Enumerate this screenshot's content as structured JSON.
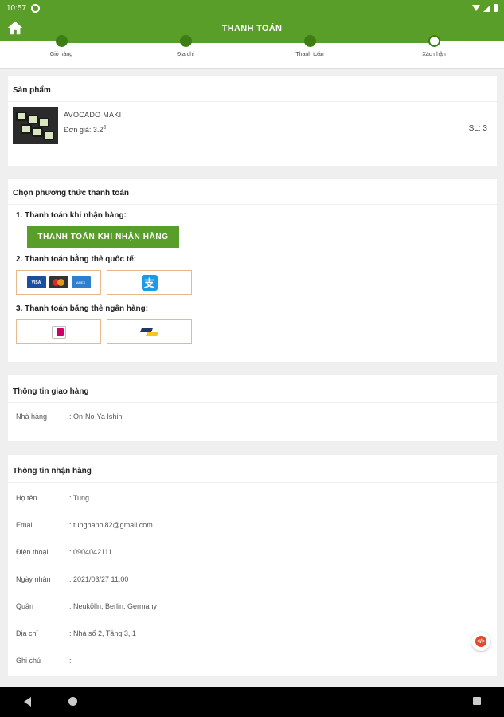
{
  "status_bar": {
    "time": "10:57"
  },
  "app_bar": {
    "title": "THANH TOÁN"
  },
  "steps": [
    {
      "label": "Giỏ hàng",
      "done": true
    },
    {
      "label": "Địa chỉ",
      "done": true
    },
    {
      "label": "Thanh toán",
      "done": true
    },
    {
      "label": "Xác nhận",
      "done": false
    }
  ],
  "product_section": {
    "title": "Sản phẩm",
    "item": {
      "name": "AVOCADO MAKI",
      "price_label": "Đơn giá: 3.2",
      "currency_sup": "đ",
      "qty": "SL: 3"
    }
  },
  "payment_section": {
    "title": "Chọn phương thức thanh toán",
    "option1_label": "1. Thanh toán khi nhận hàng:",
    "cod_button": "THANH TOÁN KHI NHẬN HÀNG",
    "option2_label": "2. Thanh toán bằng thẻ quốc tế:",
    "option3_label": "3. Thanh toán bằng thẻ ngân hàng:",
    "visa_text": "VISA",
    "amex_text": "AMEX",
    "alipay_glyph": "支"
  },
  "delivery_section": {
    "title": "Thông tin giao hàng",
    "rows": [
      {
        "key": "Nhà hàng",
        "value": ": On-No-Ya Ishin"
      }
    ]
  },
  "receiver_section": {
    "title": "Thông tin nhận hàng",
    "rows": [
      {
        "key": "Họ tên",
        "value": ": Tung"
      },
      {
        "key": "Email",
        "value": ": tunghanoi82@gmail.com"
      },
      {
        "key": "Điện thoại",
        "value": ": 0904042111"
      },
      {
        "key": "Ngày nhận",
        "value": ": 2021/03/27 11:00"
      },
      {
        "key": "Quận",
        "value": ": Neukölln, Berlin, Germany"
      },
      {
        "key": "Địa chỉ",
        "value": ": Nhà số 2, Tầng 3, 1"
      },
      {
        "key": "Ghi chú",
        "value": ":"
      }
    ]
  },
  "fab": {
    "glyph": "</>"
  },
  "colors": {
    "brand_green": "#5a9e2a",
    "step_green": "#3e7d16",
    "card_border": "#e6b98a"
  }
}
